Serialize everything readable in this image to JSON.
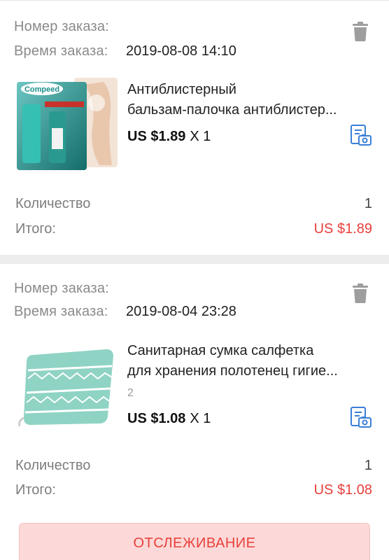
{
  "orders": [
    {
      "order_number_label": "Номер заказа:",
      "order_time_label": "Время заказа:",
      "order_time": "2019-08-08 14:10",
      "product_title_line1": "Антиблистерный",
      "product_title_line2": "бальзам-палочка антиблистер...",
      "price": "US $1.89",
      "quantity_text": "X 1",
      "quantity_label": "Количество",
      "quantity_value": "1",
      "total_label": "Итого:",
      "total_value": "US $1.89",
      "image_brand_text": "Compeed"
    },
    {
      "order_number_label": "Номер заказа:",
      "order_time_label": "Время заказа:",
      "order_time": "2019-08-04 23:28",
      "product_title_line1": "Санитарная сумка салфетка",
      "product_title_line2": "для хранения полотенец гигие...",
      "variant": "2",
      "price": "US $1.08",
      "quantity_text": "X 1",
      "quantity_label": "Количество",
      "quantity_value": "1",
      "total_label": "Итого:",
      "total_value": "US $1.08"
    }
  ],
  "track_button_label": "ОТСЛЕЖИВАНИЕ",
  "colors": {
    "accent_red": "#e8403c",
    "icon_blue": "#3b7fd6",
    "label_gray": "#8a8a8a"
  },
  "icons": [
    "trash-icon",
    "photo-review-icon"
  ]
}
